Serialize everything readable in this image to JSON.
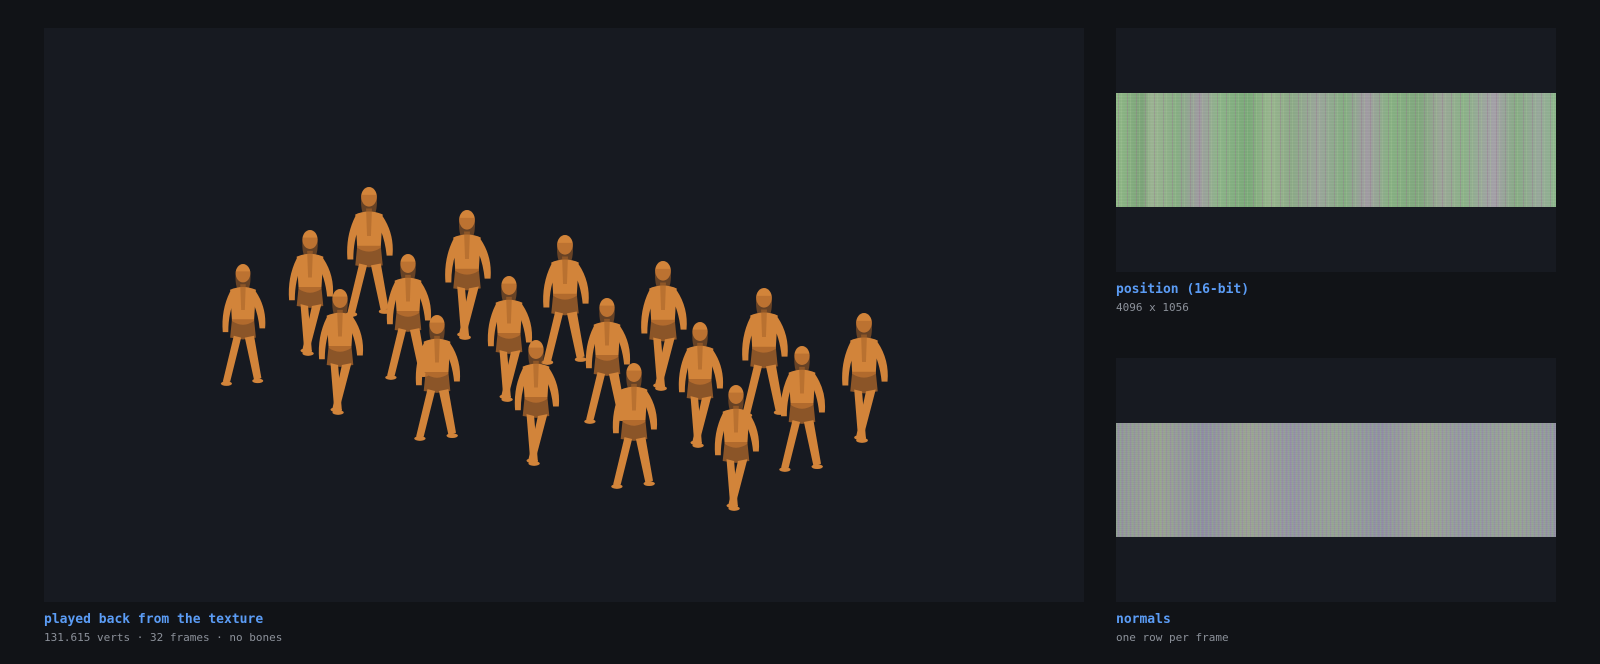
{
  "viewport": {
    "caption_title": "played back from the texture",
    "caption_sub": "131.615 verts · 32 frames · no bones",
    "figure_color": "#d2843a",
    "background": "#171a21"
  },
  "position_texture": {
    "caption_title": "position (16-bit)",
    "caption_sub": "4096 x 1056"
  },
  "normals_texture": {
    "caption_title": "normals",
    "caption_sub": "one row per frame"
  },
  "colors": {
    "page_bg": "#111317",
    "panel_bg": "#171a21",
    "accent": "#5b9cf5",
    "muted_text": "#8b9099"
  }
}
